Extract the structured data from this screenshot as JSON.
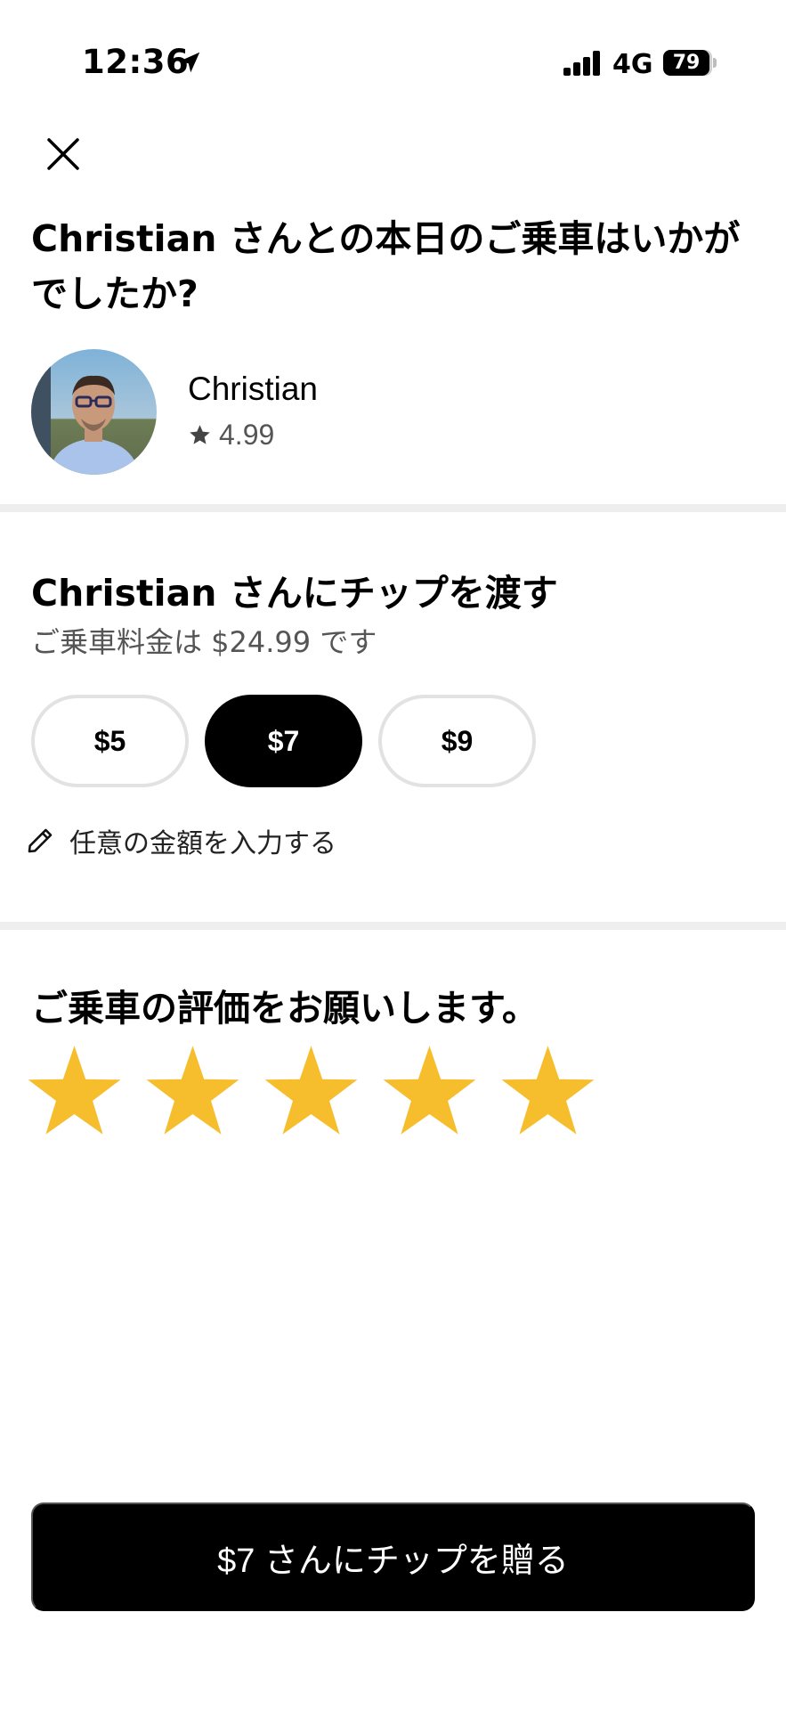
{
  "status_bar": {
    "time": "12:36",
    "network": "4G",
    "battery": "79"
  },
  "header": {
    "close_icon": "close-icon",
    "title": "Christian さんとの本日のご乗車はいかがでしたか?"
  },
  "driver": {
    "name": "Christian",
    "rating": "4.99"
  },
  "tip": {
    "title": "Christian さんにチップを渡す",
    "fare_text": "ご乗車料金は $24.99 です",
    "options": [
      "$5",
      "$7",
      "$9"
    ],
    "selected": "$7",
    "custom_label": "任意の金額を入力する"
  },
  "rating_section": {
    "title": "ご乗車の評価をお願いします。",
    "stars_selected": 5,
    "stars_total": 5,
    "star_color": "#F6BE2D"
  },
  "submit": {
    "label": "$7 さんにチップを贈る"
  },
  "colors": {
    "primary": "#000000",
    "divider": "#EEEEEE",
    "muted_text": "#555555"
  }
}
